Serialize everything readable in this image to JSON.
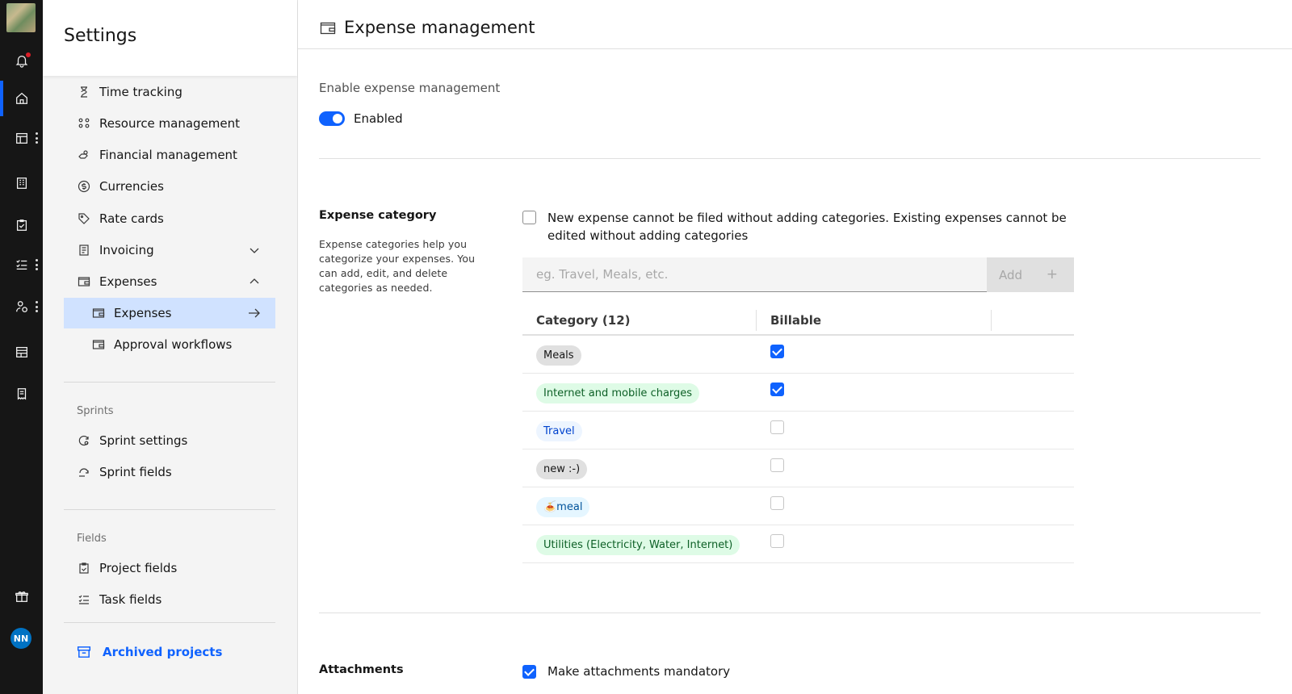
{
  "rail": {
    "items": [
      {
        "name": "notifications-icon"
      },
      {
        "name": "home-icon"
      },
      {
        "name": "calendar-icon"
      },
      {
        "name": "building-icon"
      },
      {
        "name": "clipboard-icon"
      },
      {
        "name": "task-list-icon"
      },
      {
        "name": "people-icon"
      },
      {
        "name": "table-icon"
      },
      {
        "name": "receipt-icon"
      },
      {
        "name": "gift-icon"
      }
    ],
    "avatar_initials": "NN"
  },
  "settings": {
    "title": "Settings",
    "items": [
      {
        "label": "Time tracking",
        "icon": "hourglass-icon"
      },
      {
        "label": "Resource management",
        "icon": "group-icon"
      },
      {
        "label": "Financial management",
        "icon": "money-hand-icon"
      },
      {
        "label": "Currencies",
        "icon": "currency-icon"
      },
      {
        "label": "Rate cards",
        "icon": "tag-icon"
      },
      {
        "label": "Invoicing",
        "icon": "invoice-icon"
      },
      {
        "label": "Expenses",
        "icon": "wallet-icon"
      }
    ],
    "sub_items": [
      {
        "label": "Expenses",
        "icon": "wallet-icon"
      },
      {
        "label": "Approval workflows",
        "icon": "wallet-icon"
      }
    ],
    "sprints_label": "Sprints",
    "sprint_items": [
      {
        "label": "Sprint settings",
        "icon": "sprint-settings-icon"
      },
      {
        "label": "Sprint fields",
        "icon": "sprint-fields-icon"
      }
    ],
    "fields_label": "Fields",
    "field_items": [
      {
        "label": "Project fields",
        "icon": "clipboard-icon"
      },
      {
        "label": "Task fields",
        "icon": "task-list-icon"
      }
    ],
    "archived_label": "Archived projects"
  },
  "main": {
    "title": "Expense management",
    "enable_label": "Enable expense management",
    "toggle_text": "Enabled",
    "toggle_on": true,
    "category": {
      "title": "Expense category",
      "description": "Expense categories help you categorize your expenses. You can add, edit, and delete categories as needed.",
      "require_text": "New expense cannot be filed without adding categories. Existing expenses cannot be edited without adding categories",
      "require_checked": false,
      "input_placeholder": "eg. Travel, Meals, etc.",
      "add_label": "Add",
      "add_plus": "+",
      "col_category": "Category (12)",
      "col_billable": "Billable",
      "rows": [
        {
          "name": "Meals",
          "billable": true,
          "tag": "gray"
        },
        {
          "name": "Internet and mobile charges",
          "billable": true,
          "tag": "green"
        },
        {
          "name": "Travel",
          "billable": false,
          "tag": "blue"
        },
        {
          "name": "new :-)",
          "billable": false,
          "tag": "gray"
        },
        {
          "name": "🍝meal",
          "billable": false,
          "tag": "teal"
        },
        {
          "name": "Utilities (Electricity, Water, Internet)",
          "billable": false,
          "tag": "green"
        }
      ]
    },
    "attachments": {
      "title": "Attachments",
      "mandatory_text": "Make attachments mandatory",
      "mandatory_checked": true
    }
  },
  "colors": {
    "accent": "#0f62fe",
    "rail_bg": "#161616",
    "selected_bg": "#d0e2ff"
  }
}
